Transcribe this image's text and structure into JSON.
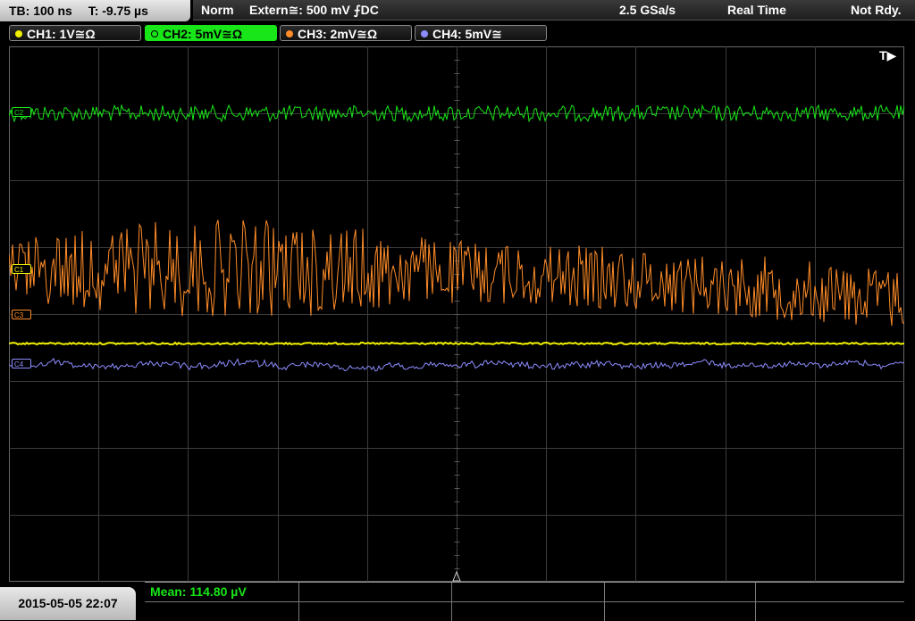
{
  "topbar": {
    "timebase": "TB: 100 ns",
    "trigger_time": "T: -9.75 µs",
    "mode": "Norm",
    "trigger_source": "Extern≅: 500 mV ⨍DC",
    "sample_rate": "2.5 GSa/s",
    "acq_mode": "Real Time",
    "status": "Not Rdy."
  },
  "channels": [
    {
      "label": "CH1: 1V≅Ω",
      "color": "#f0f000",
      "active": false
    },
    {
      "label": "CH2: 5mV≅Ω",
      "color": "#19e619",
      "active": true
    },
    {
      "label": "CH3: 2mV≅Ω",
      "color": "#ff8c28",
      "active": false
    },
    {
      "label": "CH4: 5mV≅",
      "color": "#8c8cff",
      "active": false
    }
  ],
  "trigger_marker": "T▶",
  "channel_markers": [
    "C1",
    "C2",
    "C3",
    "C4"
  ],
  "measurement": {
    "mean": "Mean: 114.80 µV"
  },
  "datetime": "2015-05-05 22:07"
}
